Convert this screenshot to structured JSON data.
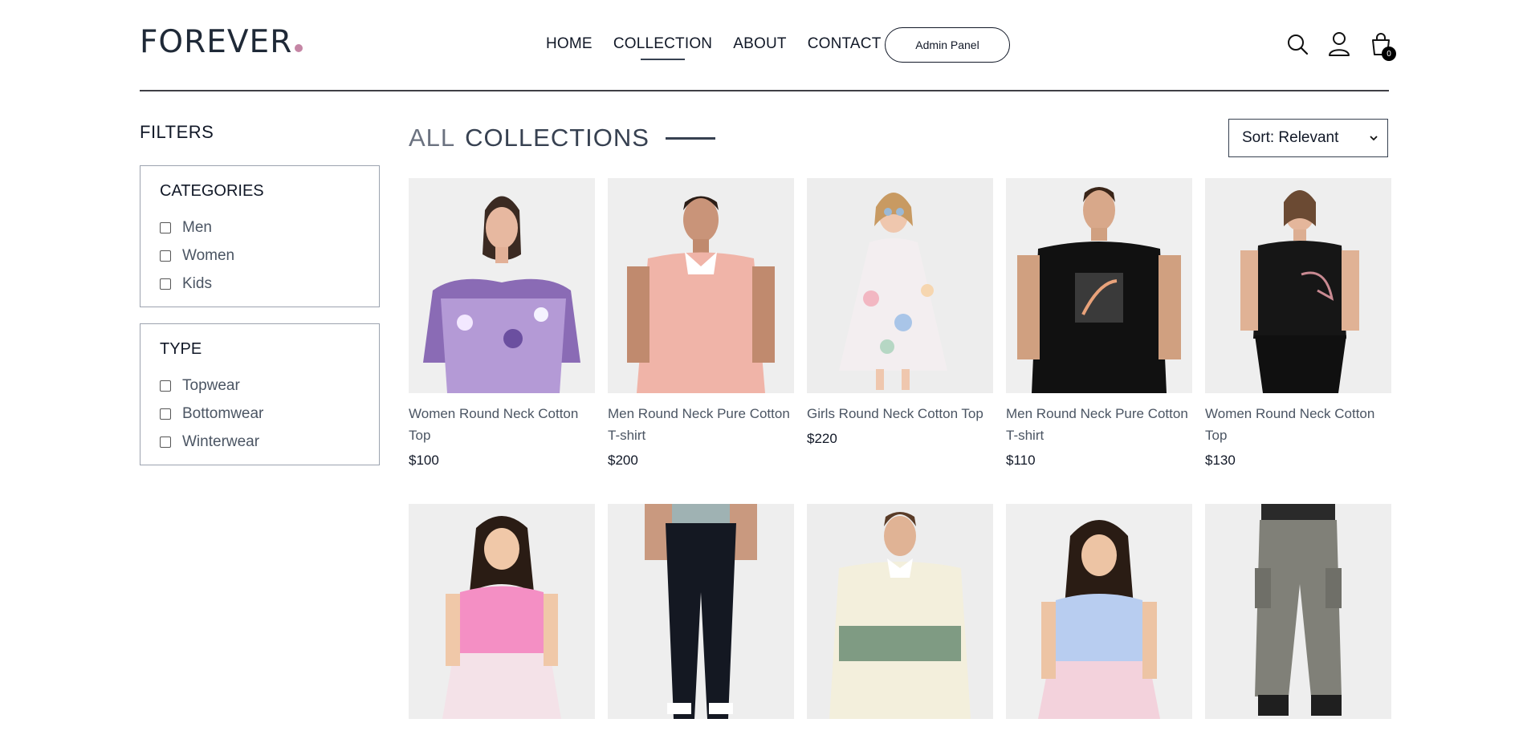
{
  "header": {
    "logo": "FOREVER",
    "nav": [
      "HOME",
      "COLLECTION",
      "ABOUT",
      "CONTACT"
    ],
    "active_nav": "COLLECTION",
    "admin_button": "Admin Panel",
    "cart_count": "0"
  },
  "filters": {
    "title": "FILTERS",
    "categories": {
      "heading": "CATEGORIES",
      "options": [
        "Men",
        "Women",
        "Kids"
      ]
    },
    "type": {
      "heading": "TYPE",
      "options": [
        "Topwear",
        "Bottomwear",
        "Winterwear"
      ]
    }
  },
  "collection": {
    "title_light": "ALL",
    "title_dark": "COLLECTIONS",
    "sort_value": "Sort: Relevant"
  },
  "products": [
    {
      "name": "Women Round Neck Cotton Top",
      "price": "$100"
    },
    {
      "name": "Men Round Neck Pure Cotton T-shirt",
      "price": "$200"
    },
    {
      "name": "Girls Round Neck Cotton Top",
      "price": "$220"
    },
    {
      "name": "Men Round Neck Pure Cotton T-shirt",
      "price": "$110"
    },
    {
      "name": "Women Round Neck Cotton Top",
      "price": "$130"
    }
  ],
  "colors": {
    "accent_dot": "#c586a5",
    "text_dark": "#111827",
    "text_muted": "#4b5563"
  }
}
